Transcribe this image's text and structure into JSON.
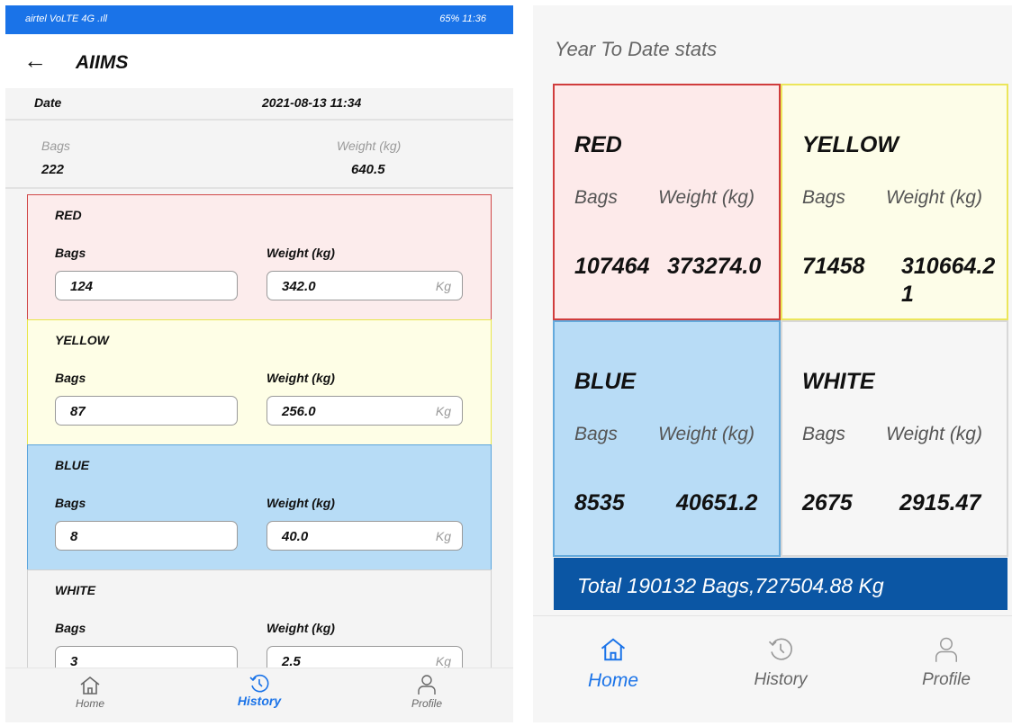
{
  "status_bar": {
    "left": "airtel VoLTE 4G .ıll",
    "right": "65% 11:36"
  },
  "detail": {
    "title": "AIIMS",
    "date_label": "Date",
    "date_value": "2021-08-13 11:34",
    "bags_label": "Bags",
    "weight_label": "Weight (kg)",
    "bags_value": "222",
    "weight_value": "640.5",
    "categories": [
      {
        "name": "RED",
        "bags_label": "Bags",
        "weight_label": "Weight (kg)",
        "bags": "124",
        "weight": "342.0",
        "unit": "Kg",
        "color": "#fcecec",
        "border": "#d04848"
      },
      {
        "name": "YELLOW",
        "bags_label": "Bags",
        "weight_label": "Weight (kg)",
        "bags": "87",
        "weight": "256.0",
        "unit": "Kg",
        "color": "#fefee6",
        "border": "#e8e64a"
      },
      {
        "name": "BLUE",
        "bags_label": "Bags",
        "weight_label": "Weight (kg)",
        "bags": "8",
        "weight": "40.0",
        "unit": "Kg",
        "color": "#b7dcf6",
        "border": "#5aa4dc"
      },
      {
        "name": "WHITE",
        "bags_label": "Bags",
        "weight_label": "Weight (kg)",
        "bags": "3",
        "weight": "2.5",
        "unit": "Kg",
        "color": "#f4f4f4",
        "border": "#d0d0d0"
      }
    ],
    "nav": {
      "home": "Home",
      "history": "History",
      "profile": "Profile",
      "active": "history"
    }
  },
  "ytd": {
    "title": "Year To Date stats",
    "tiles": [
      {
        "name": "RED",
        "bags_label": "Bags",
        "weight_label": "Weight (kg)",
        "bags": "107464",
        "weight": "373274.0",
        "color": "#fdeaea",
        "border": "#d03c3c"
      },
      {
        "name": "YELLOW",
        "bags_label": "Bags",
        "weight_label": "Weight (kg)",
        "bags": "71458",
        "weight": "310664.21",
        "color": "#fdfde8",
        "border": "#ece65a"
      },
      {
        "name": "BLUE",
        "bags_label": "Bags",
        "weight_label": "Weight (kg)",
        "bags": "8535",
        "weight": "40651.2",
        "color": "#b8dcf6",
        "border": "#64aadc"
      },
      {
        "name": "WHITE",
        "bags_label": "Bags",
        "weight_label": "Weight (kg)",
        "bags": "2675",
        "weight": "2915.47",
        "color": "#f6f6f6",
        "border": "#d8d8d8"
      }
    ],
    "total": "Total 190132 Bags,727504.88 Kg",
    "nav": {
      "home": "Home",
      "history": "History",
      "profile": "Profile",
      "active": "home"
    }
  },
  "colors": {
    "status_bar": "#1a73e8",
    "active_nav": "#1a73e8",
    "inactive_nav": "#666666",
    "total_bar": "#0b56a4"
  }
}
